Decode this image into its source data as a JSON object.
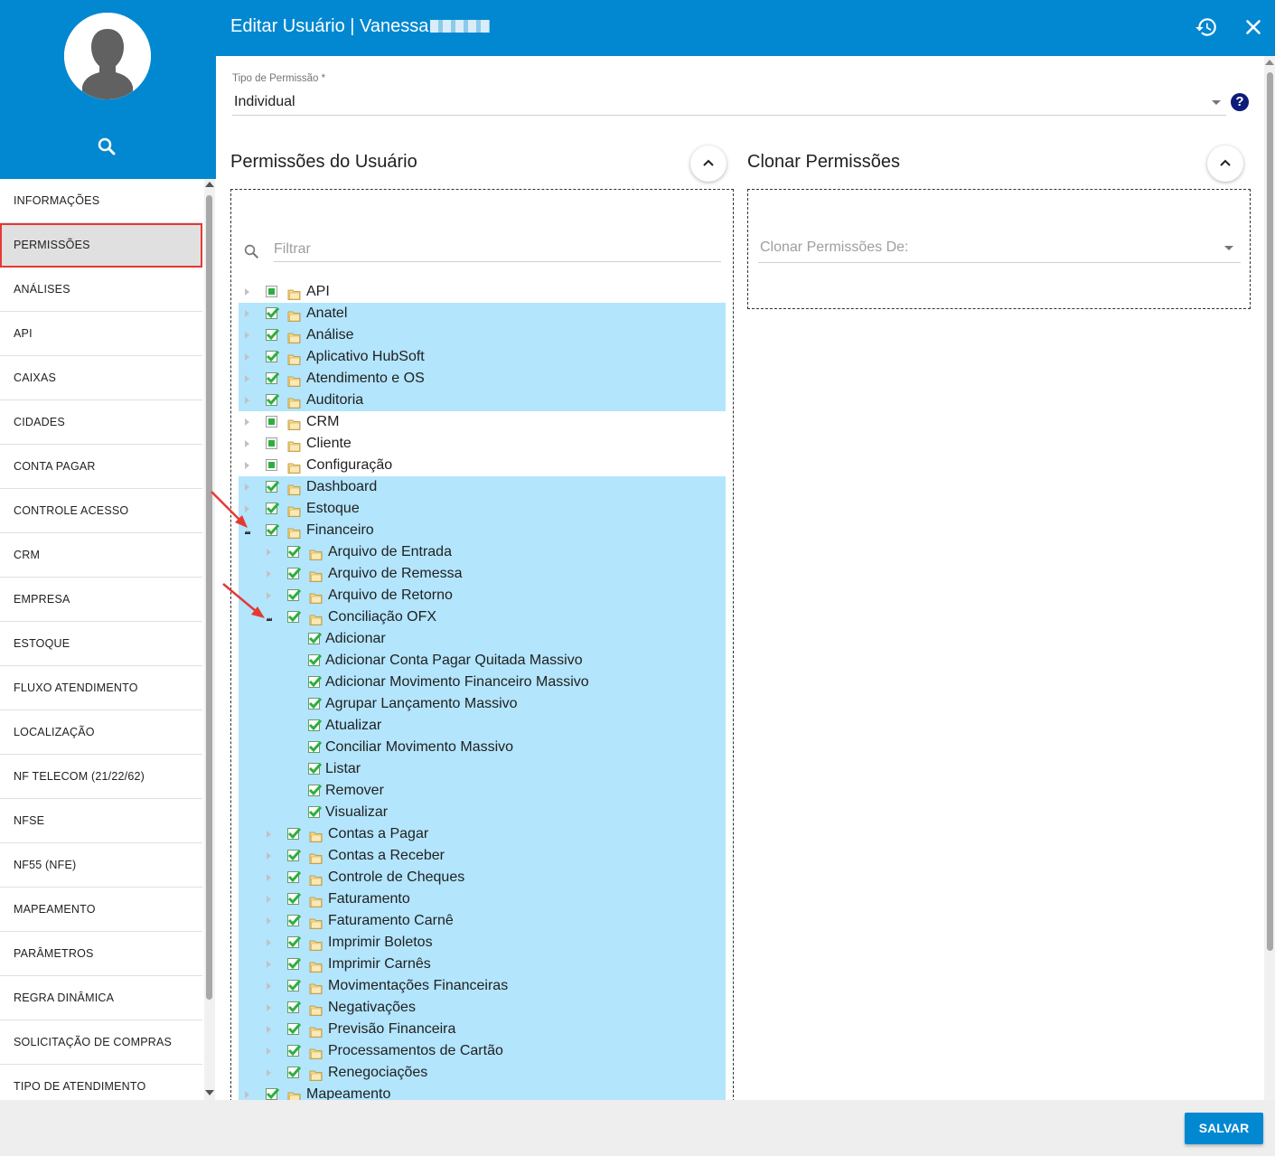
{
  "header": {
    "title": "Editar Usuário | Vanessa"
  },
  "sidebar": {
    "items": [
      {
        "label": "INFORMAÇÕES",
        "active": false
      },
      {
        "label": "PERMISSÕES",
        "active": true
      },
      {
        "label": "ANÁLISES",
        "active": false
      },
      {
        "label": "API",
        "active": false
      },
      {
        "label": "CAIXAS",
        "active": false
      },
      {
        "label": "CIDADES",
        "active": false
      },
      {
        "label": "CONTA PAGAR",
        "active": false
      },
      {
        "label": "CONTROLE ACESSO",
        "active": false
      },
      {
        "label": "CRM",
        "active": false
      },
      {
        "label": "EMPRESA",
        "active": false
      },
      {
        "label": "ESTOQUE",
        "active": false
      },
      {
        "label": "FLUXO ATENDIMENTO",
        "active": false
      },
      {
        "label": "LOCALIZAÇÃO",
        "active": false
      },
      {
        "label": "NF TELECOM (21/22/62)",
        "active": false
      },
      {
        "label": "NFSe",
        "active": false
      },
      {
        "label": "NF55 (NFe)",
        "active": false
      },
      {
        "label": "MAPEAMENTO",
        "active": false
      },
      {
        "label": "PARÂMETROS",
        "active": false
      },
      {
        "label": "REGRA DINÂMICA",
        "active": false
      },
      {
        "label": "SOLICITAÇÃO DE COMPRAS",
        "active": false
      },
      {
        "label": "TIPO DE ATENDIMENTO",
        "active": false
      }
    ]
  },
  "permission_type": {
    "label": "Tipo de Permissão *",
    "value": "Individual"
  },
  "user_permissions": {
    "title": "Permissões do Usuário",
    "filter_placeholder": "Filtrar",
    "tree": [
      {
        "label": "API",
        "level": 0,
        "toggle": "closed",
        "check": "partial",
        "folder": true,
        "selected": false
      },
      {
        "label": "Anatel",
        "level": 0,
        "toggle": "closed",
        "check": "full",
        "folder": true,
        "selected": true
      },
      {
        "label": "Análise",
        "level": 0,
        "toggle": "closed",
        "check": "full",
        "folder": true,
        "selected": true
      },
      {
        "label": "Aplicativo HubSoft",
        "level": 0,
        "toggle": "closed",
        "check": "full",
        "folder": true,
        "selected": true
      },
      {
        "label": "Atendimento e OS",
        "level": 0,
        "toggle": "closed",
        "check": "full",
        "folder": true,
        "selected": true
      },
      {
        "label": "Auditoria",
        "level": 0,
        "toggle": "closed",
        "check": "full",
        "folder": true,
        "selected": true
      },
      {
        "label": "CRM",
        "level": 0,
        "toggle": "closed",
        "check": "partial",
        "folder": true,
        "selected": false
      },
      {
        "label": "Cliente",
        "level": 0,
        "toggle": "closed",
        "check": "partial",
        "folder": true,
        "selected": false
      },
      {
        "label": "Configuração",
        "level": 0,
        "toggle": "closed",
        "check": "partial",
        "folder": true,
        "selected": false
      },
      {
        "label": "Dashboard",
        "level": 0,
        "toggle": "closed",
        "check": "full",
        "folder": true,
        "selected": true
      },
      {
        "label": "Estoque",
        "level": 0,
        "toggle": "closed",
        "check": "full",
        "folder": true,
        "selected": true
      },
      {
        "label": "Financeiro",
        "level": 0,
        "toggle": "open",
        "check": "full",
        "folder": true,
        "selected": true
      },
      {
        "label": "Arquivo de Entrada",
        "level": 1,
        "toggle": "closed",
        "check": "full",
        "folder": true,
        "selected": true
      },
      {
        "label": "Arquivo de Remessa",
        "level": 1,
        "toggle": "closed",
        "check": "full",
        "folder": true,
        "selected": true
      },
      {
        "label": "Arquivo de Retorno",
        "level": 1,
        "toggle": "closed",
        "check": "full",
        "folder": true,
        "selected": true
      },
      {
        "label": "Conciliação OFX",
        "level": 1,
        "toggle": "open",
        "check": "full",
        "folder": true,
        "selected": true
      },
      {
        "label": "Adicionar",
        "level": 2,
        "toggle": "none",
        "check": "full",
        "folder": false,
        "selected": true
      },
      {
        "label": "Adicionar Conta Pagar Quitada Massivo",
        "level": 2,
        "toggle": "none",
        "check": "full",
        "folder": false,
        "selected": true
      },
      {
        "label": "Adicionar Movimento Financeiro Massivo",
        "level": 2,
        "toggle": "none",
        "check": "full",
        "folder": false,
        "selected": true
      },
      {
        "label": "Agrupar Lançamento Massivo",
        "level": 2,
        "toggle": "none",
        "check": "full",
        "folder": false,
        "selected": true
      },
      {
        "label": "Atualizar",
        "level": 2,
        "toggle": "none",
        "check": "full",
        "folder": false,
        "selected": true
      },
      {
        "label": "Conciliar Movimento Massivo",
        "level": 2,
        "toggle": "none",
        "check": "full",
        "folder": false,
        "selected": true
      },
      {
        "label": "Listar",
        "level": 2,
        "toggle": "none",
        "check": "full",
        "folder": false,
        "selected": true
      },
      {
        "label": "Remover",
        "level": 2,
        "toggle": "none",
        "check": "full",
        "folder": false,
        "selected": true
      },
      {
        "label": "Visualizar",
        "level": 2,
        "toggle": "none",
        "check": "full",
        "folder": false,
        "selected": true
      },
      {
        "label": "Contas a Pagar",
        "level": 1,
        "toggle": "closed",
        "check": "full",
        "folder": true,
        "selected": true
      },
      {
        "label": "Contas a Receber",
        "level": 1,
        "toggle": "closed",
        "check": "full",
        "folder": true,
        "selected": true
      },
      {
        "label": "Controle de Cheques",
        "level": 1,
        "toggle": "closed",
        "check": "full",
        "folder": true,
        "selected": true
      },
      {
        "label": "Faturamento",
        "level": 1,
        "toggle": "closed",
        "check": "full",
        "folder": true,
        "selected": true
      },
      {
        "label": "Faturamento Carnê",
        "level": 1,
        "toggle": "closed",
        "check": "full",
        "folder": true,
        "selected": true
      },
      {
        "label": "Imprimir Boletos",
        "level": 1,
        "toggle": "closed",
        "check": "full",
        "folder": true,
        "selected": true
      },
      {
        "label": "Imprimir Carnês",
        "level": 1,
        "toggle": "closed",
        "check": "full",
        "folder": true,
        "selected": true
      },
      {
        "label": "Movimentações Financeiras",
        "level": 1,
        "toggle": "closed",
        "check": "full",
        "folder": true,
        "selected": true
      },
      {
        "label": "Negativações",
        "level": 1,
        "toggle": "closed",
        "check": "full",
        "folder": true,
        "selected": true
      },
      {
        "label": "Previsão Financeira",
        "level": 1,
        "toggle": "closed",
        "check": "full",
        "folder": true,
        "selected": true
      },
      {
        "label": "Processamentos de Cartão",
        "level": 1,
        "toggle": "closed",
        "check": "full",
        "folder": true,
        "selected": true
      },
      {
        "label": "Renegociações",
        "level": 1,
        "toggle": "closed",
        "check": "full",
        "folder": true,
        "selected": true
      },
      {
        "label": "Mapeamento",
        "level": 0,
        "toggle": "closed",
        "check": "full",
        "folder": true,
        "selected": true
      }
    ]
  },
  "clone_permissions": {
    "title": "Clonar Permissões",
    "select_placeholder": "Clonar Permissões De:"
  },
  "footer": {
    "save_label": "SALVAR"
  },
  "colors": {
    "primary": "#0288d1",
    "selected_row": "#b3e5fc",
    "check_green": "#2eae3f",
    "active_outline": "#e53935",
    "annotation_arrow": "#e53935"
  },
  "icons": {
    "avatar": "user-silhouette-icon",
    "search": "search-icon",
    "history": "history-icon",
    "close": "close-icon",
    "help": "help-icon",
    "collapse": "chevron-up-icon",
    "folder": "folder-icon"
  }
}
